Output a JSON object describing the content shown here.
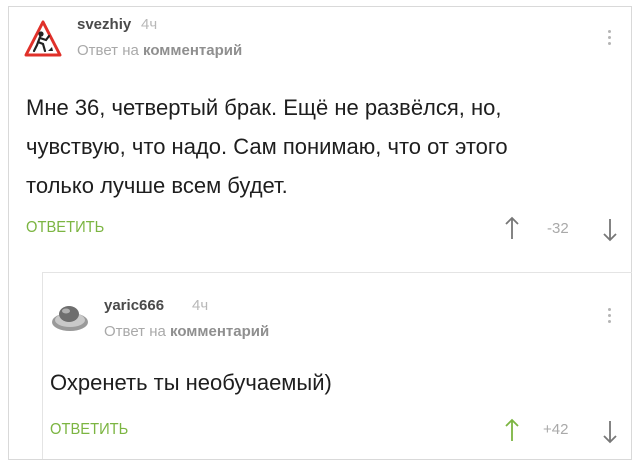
{
  "comments": [
    {
      "username": "svezhiy",
      "time": "4ч",
      "reply_prefix": "Ответ на",
      "reply_target": "комментарий",
      "text_lines": [
        "Мне 36, четвертый брак. Ещё не развёлся, но,",
        "чувствую, что надо. Сам понимаю, что от этого",
        "только лучше всем будет."
      ],
      "reply_label": "ОТВЕТИТЬ",
      "score": "-32"
    },
    {
      "username": "yaric666",
      "time": "4ч",
      "reply_prefix": "Ответ на",
      "reply_target": "комментарий",
      "text_lines": [
        "Охренеть ты необучаемый)"
      ],
      "reply_label": "ОТВЕТИТЬ",
      "score": "+42"
    }
  ],
  "icons": {
    "avatar1": "road-works-sign-icon",
    "avatar2": "egg-on-plate-icon",
    "upvote": "arrow-up-icon",
    "downvote": "arrow-down-icon",
    "menu": "more-vertical-icon"
  },
  "colors": {
    "accent": "#7cb542",
    "upvote_active": "#7cb542",
    "text": "#1e1e1e",
    "muted": "#a9a9a9",
    "warning_sign": "#e0312a"
  }
}
